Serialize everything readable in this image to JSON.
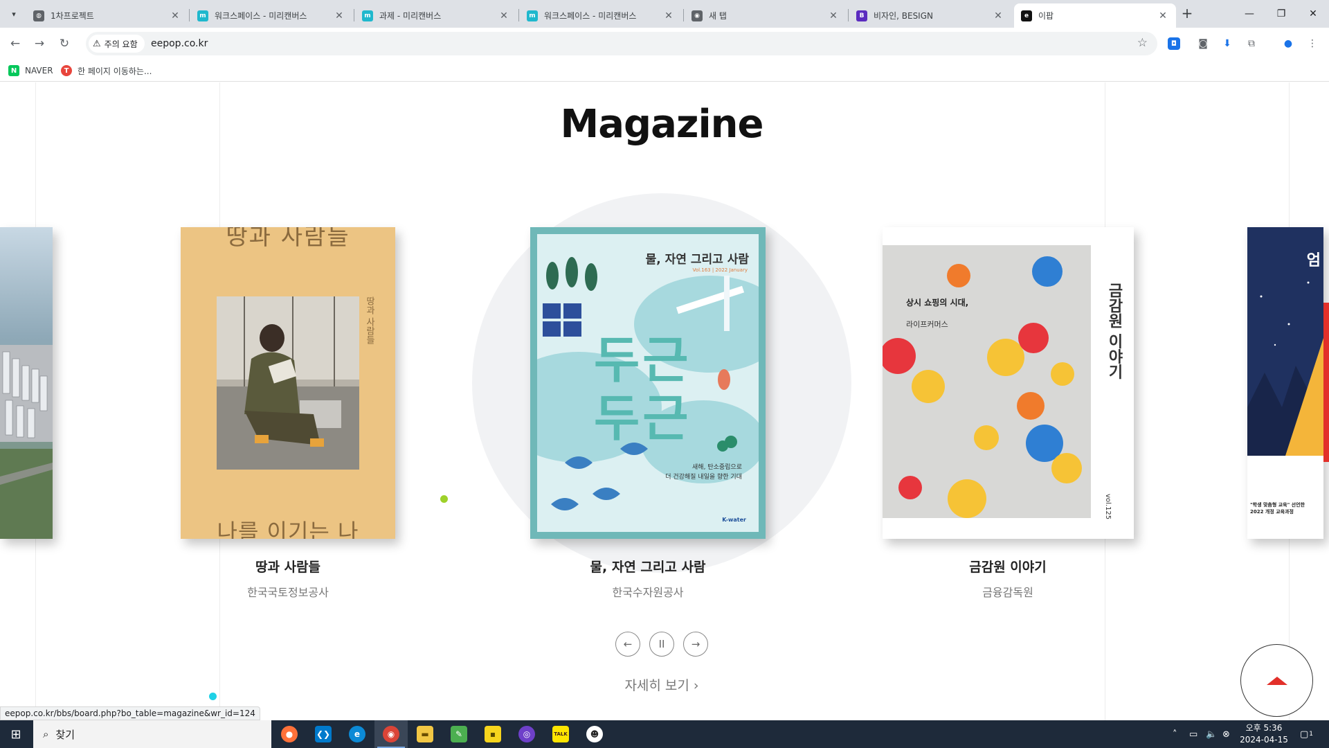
{
  "browser": {
    "tabs": [
      {
        "label": "1차프로젝트",
        "icon": "globe-icon",
        "color": "#5f6368"
      },
      {
        "label": "워크스페이스 - 미리캔버스",
        "icon": "miricanvas-icon",
        "color": "#1fb8cd"
      },
      {
        "label": "과제 - 미리캔버스",
        "icon": "miricanvas-icon",
        "color": "#1fb8cd"
      },
      {
        "label": "워크스페이스 - 미리캔버스",
        "icon": "miricanvas-icon",
        "color": "#1fb8cd"
      },
      {
        "label": "새 탭",
        "icon": "chrome-icon",
        "color": "#5f6368"
      },
      {
        "label": "비자인, BESIGN",
        "icon": "besign-icon",
        "color": "#5b2bbf"
      },
      {
        "label": "이팝",
        "icon": "eepop-icon",
        "color": "#111111"
      }
    ],
    "new_tab": "+",
    "window_controls": {
      "minimize": "—",
      "restore": "❐",
      "close": "✕"
    },
    "security_label": "주의 요함",
    "url": "eepop.co.kr",
    "bookmarks": [
      {
        "label": "NAVER",
        "icon": "naver-icon",
        "color": "#03c75a"
      },
      {
        "label": "한 페이지 이동하는...",
        "icon": "bookmark-dot-icon",
        "color": "#e8453c"
      }
    ],
    "status_url": "eepop.co.kr/bbs/board.php?bo_table=magazine&wr_id=124"
  },
  "page": {
    "section_title": "Magazine",
    "cards": [
      {
        "title": "땅과 사람들",
        "publisher": "한국국토정보공사"
      },
      {
        "title": "물, 자연 그리고 사람",
        "publisher": "한국수자원공사"
      },
      {
        "title": "금감원 이야기",
        "publisher": "금융감독원"
      }
    ],
    "covers": {
      "land": {
        "top_text": "땅과 사람들",
        "bottom_text": "나를 이기는 나",
        "side_text": "땅과 사람들"
      },
      "water": {
        "title": "물, 자연 그리고 사람",
        "meta": "Vol.163 | 2022 January",
        "headline_1": "두근",
        "headline_2": "두근",
        "body_1": "새해, 탄소중립으로",
        "body_2": "더 건강해질 내일을 향한 기대",
        "brand": "K-water"
      },
      "fss": {
        "headline": "상시 쇼핑의 시대,",
        "sub": "라이프커머스",
        "side_title": "금감원 이야기",
        "vol": "vol.125"
      },
      "right": {
        "char": "엄",
        "text_1": "\"학생 맞춤형 교육\" 선언한",
        "text_2": "2022 개정 교육과정"
      }
    },
    "controls": {
      "prev": "←",
      "pause": "II",
      "next": "→"
    },
    "more_link": "자세히 보기 ›",
    "top_button": "scroll-to-top"
  },
  "taskbar": {
    "search_placeholder": "찾기",
    "apps": [
      {
        "name": "firefox-icon",
        "color": "#ff7139",
        "glyph": "●"
      },
      {
        "name": "vscode-icon",
        "color": "#007acc",
        "glyph": "❮❯"
      },
      {
        "name": "edge-icon",
        "color": "#0c8ad6",
        "glyph": "e"
      },
      {
        "name": "chrome-icon",
        "color": "#db4437",
        "glyph": "◉"
      },
      {
        "name": "file-explorer-icon",
        "color": "#f2c744",
        "glyph": "▬"
      },
      {
        "name": "notepad-icon",
        "color": "#4caf50",
        "glyph": "✎"
      },
      {
        "name": "sticky-notes-icon",
        "color": "#f7d51d",
        "glyph": "▪"
      },
      {
        "name": "github-desktop-icon",
        "color": "#6e40c9",
        "glyph": "◎"
      },
      {
        "name": "kakaotalk-icon",
        "color": "#fee500",
        "glyph": "TALK"
      },
      {
        "name": "emoji-app-icon",
        "color": "#ffffff",
        "glyph": "☻"
      }
    ],
    "time": "오후 5:36",
    "date": "2024-04-15",
    "notification_count": "1"
  }
}
